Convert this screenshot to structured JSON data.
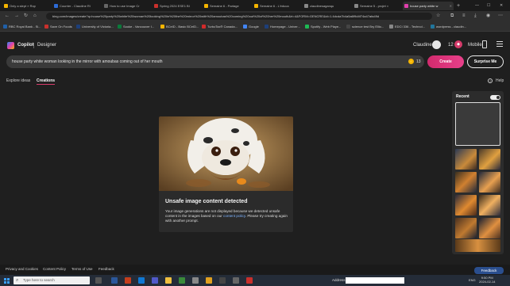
{
  "browser": {
    "tabs": [
      {
        "label": "Only a slept » Rop",
        "color": "#f4b400"
      },
      {
        "label": "Courrier - Claudine Ri",
        "color": "#2d6bd6"
      },
      {
        "label": "How to use Image Cr",
        "color": "#444"
      },
      {
        "label": "Spring 2024 ESE1 Bl",
        "color": "#c9302c"
      },
      {
        "label": "Semaine 6 - Partage",
        "color": "#f4b400"
      },
      {
        "label": "Semaine 6 - L'éduca",
        "color": "#f4b400"
      },
      {
        "label": "claudinesaganqu",
        "color": "#888"
      },
      {
        "label": "Semaine 5 - projet ×",
        "color": "#888"
      },
      {
        "label": "house party white w",
        "color": "#e23fae",
        "active": true
      }
    ],
    "url": "bing.com/images/create?q=house%20party%20white%20woman%20looking%20in%20the%20mirror%20with%20amoubas%20coming%20out%20of%20her%20mouth&rt=4&FORM=GENCRE&id=1.4dcda7b4a5a6f9d4f74a47afa49d",
    "bookmarks": [
      {
        "label": "RBC Royal Bank - Si...",
        "color": "#1f5fa8"
      },
      {
        "label": "Save On Foods",
        "color": "#c9302c"
      },
      {
        "label": "University of Victoria...",
        "color": "#1d3f7a"
      },
      {
        "label": "Soo‌ke - Vancouver I...",
        "color": "#0a7a3a"
      },
      {
        "label": "BCeID - Basic BCeID...",
        "color": "#f4b400"
      },
      {
        "label": "TurboTax® Canada...",
        "color": "#d12a2a"
      },
      {
        "label": "Google",
        "color": "#4285f4"
      },
      {
        "label": "Homepage - Univer...",
        "color": "#1d3f7a"
      },
      {
        "label": "Spotify - Web Playe...",
        "color": "#1db954"
      },
      {
        "label": "science test Bry Ellio...",
        "color": "#444"
      },
      {
        "label": "EDCI 336 - Technol...",
        "color": "#888"
      },
      {
        "label": "wordpress - claudin...",
        "color": "#21759b"
      }
    ]
  },
  "header": {
    "brand": "Copilot",
    "product": "Designer",
    "username": "Claudine",
    "coins": "12",
    "coin_icon": "coin-icon",
    "mobile_label": "Mobile"
  },
  "prompt": {
    "text": "house party white woman looking in the mirror with amoubas coming out of her mouth",
    "boosts": "13",
    "create_label": "Create",
    "surprise_label": "Surprise Me"
  },
  "tabs": {
    "explore": "Explore ideas",
    "creations": "Creations",
    "help": "Help"
  },
  "result": {
    "title": "Unsafe image content detected",
    "message_pre": "Your image generations are not displayed because we detected unsafe content in the images based on our ",
    "policy_link": "content policy",
    "message_post": ". Please try creating again with another prompt."
  },
  "recent": {
    "label": "Recent",
    "toggle_on": true
  },
  "footer": {
    "links": [
      "Privacy and Cookies",
      "Content Policy",
      "Terms of Use",
      "Feedback"
    ],
    "feedback_button": "Feedback"
  },
  "taskbar": {
    "search_placeholder": "Type here to search",
    "address_label": "Address",
    "lang": "ENG",
    "time": "9:50 PM",
    "date": "2024-02-14"
  }
}
